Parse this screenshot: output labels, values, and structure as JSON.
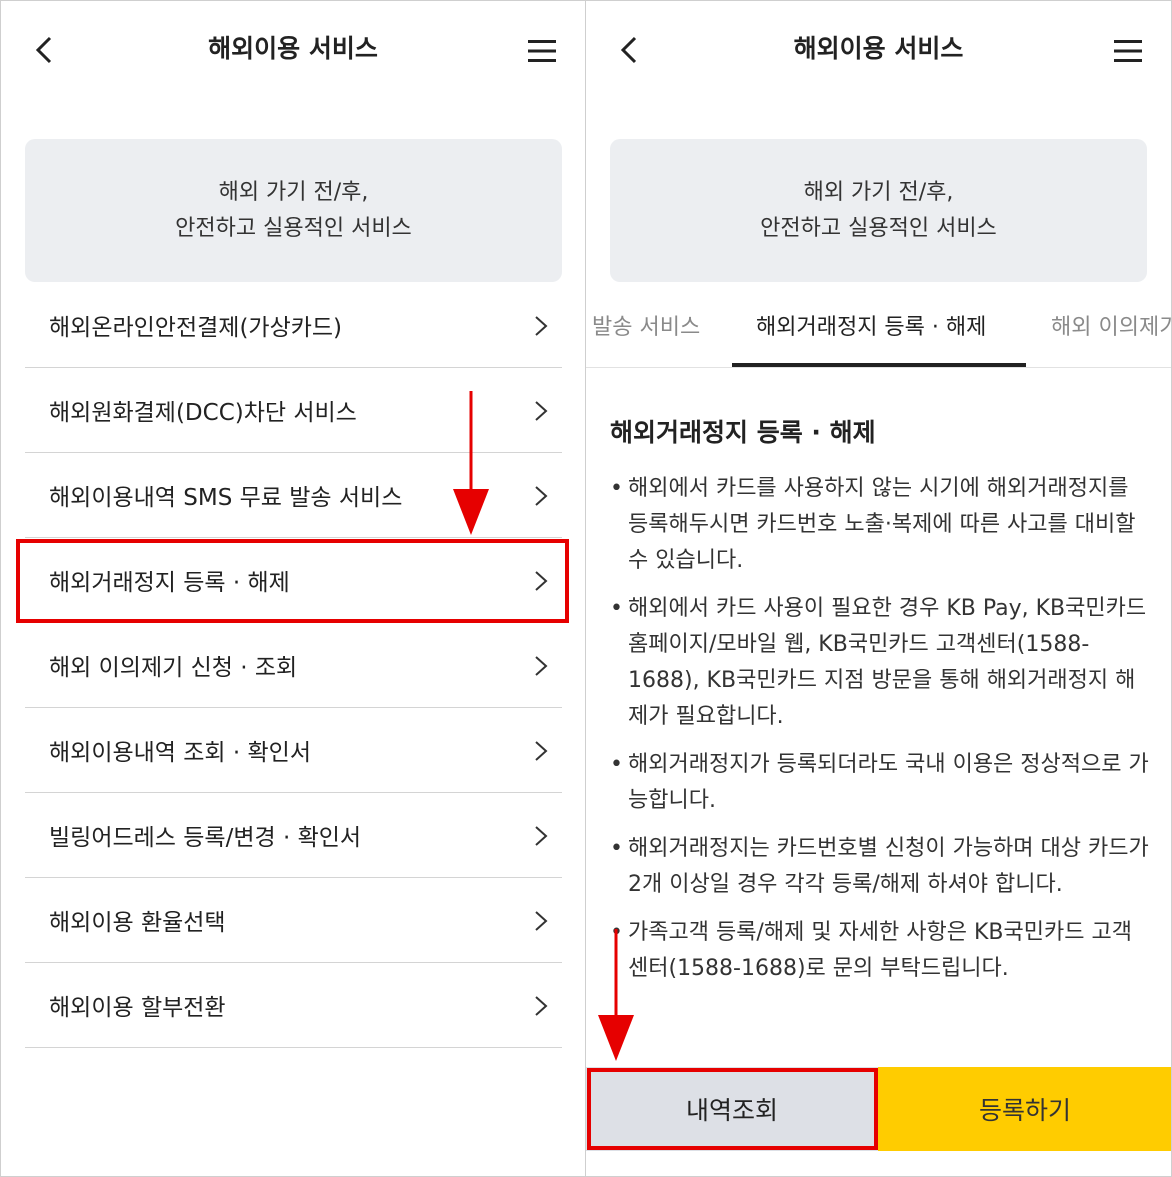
{
  "left": {
    "header": {
      "title": "해외이용 서비스"
    },
    "banner": {
      "line1": "해외 가기 전/후,",
      "line2": "안전하고 실용적인 서비스"
    },
    "items": [
      {
        "label": "해외온라인안전결제(가상카드)"
      },
      {
        "label": "해외원화결제(DCC)차단 서비스"
      },
      {
        "label": "해외이용내역 SMS 무료 발송 서비스"
      },
      {
        "label": "해외거래정지 등록 · 해제"
      },
      {
        "label": "해외 이의제기 신청 · 조회"
      },
      {
        "label": "해외이용내역 조회 · 확인서"
      },
      {
        "label": "빌링어드레스 등록/변경 · 확인서"
      },
      {
        "label": "해외이용 환율선택"
      },
      {
        "label": "해외이용 할부전환"
      }
    ]
  },
  "right": {
    "header": {
      "title": "해외이용 서비스"
    },
    "banner": {
      "line1": "해외 가기 전/후,",
      "line2": "안전하고 실용적인 서비스"
    },
    "tabs": [
      {
        "label": "발송 서비스"
      },
      {
        "label": "해외거래정지 등록 · 해제"
      },
      {
        "label": "해외 이의제기"
      }
    ],
    "section_title": "해외거래정지 등록 · 해제",
    "bullets": [
      "해외에서 카드를 사용하지 않는 시기에 해외거래정지를 등록해두시면 카드번호 노출·복제에 따른 사고를 대비할 수 있습니다.",
      "해외에서 카드 사용이 필요한 경우 KB Pay, KB국민카드 홈페이지/모바일 웹, KB국민카드 고객센터(1588-1688), KB국민카드 지점 방문을 통해 해외거래정지 해제가 필요합니다.",
      "해외거래정지가 등록되더라도 국내 이용은 정상적으로 가능합니다.",
      "해외거래정지는 카드번호별 신청이 가능하며 대상 카드가 2개 이상일 경우 각각 등록/해제 하셔야 합니다.",
      "가족고객 등록/해제 및 자세한 사항은 KB국민카드 고객센터(1588-1688)로 문의 부탁드립니다."
    ],
    "buttons": {
      "history": "내역조회",
      "register": "등록하기"
    }
  },
  "colors": {
    "highlight": "#e60000",
    "accent_yellow": "#ffcc00",
    "banner_bg": "#eceef1",
    "history_btn_bg": "#dde0e6"
  }
}
